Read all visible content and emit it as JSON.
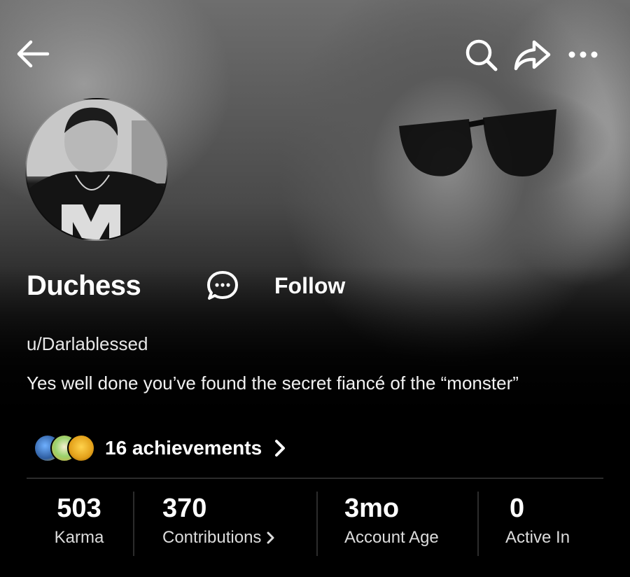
{
  "profile": {
    "display_name": "Duchess",
    "follow_label": "Follow",
    "username": "u/Darlablessed",
    "bio": "Yes well done you’ve found the secret fiancé of the “monster”",
    "achievements_label": "16 achievements"
  },
  "icons": {
    "back": "arrow-left-icon",
    "search": "search-icon",
    "share": "share-icon",
    "more": "more-horizontal-icon",
    "chat": "chat-bubble-icon",
    "chevron": "chevron-right-icon"
  },
  "stats": [
    {
      "value": "503",
      "label": "Karma"
    },
    {
      "value": "370",
      "label": "Contributions"
    },
    {
      "value": "3mo",
      "label": "Account Age"
    },
    {
      "value": "0",
      "label": "Active In"
    }
  ],
  "colors": {
    "background": "#000000",
    "text": "#ffffff",
    "muted_text": "#dcdcdc",
    "divider": "#2c2c2c"
  }
}
